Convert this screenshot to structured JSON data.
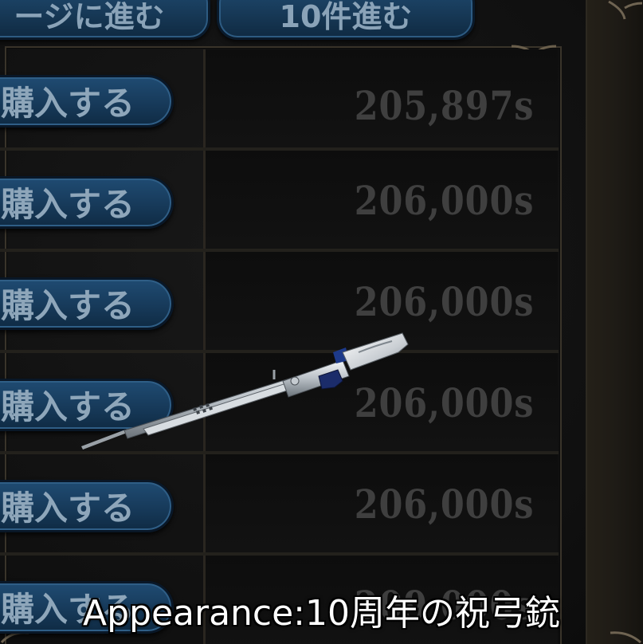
{
  "nav": {
    "prev_page_label": "ージに進む",
    "next10_label": "10件進む"
  },
  "listings": [
    {
      "buy_label": "購入する",
      "price": "205,897s"
    },
    {
      "buy_label": "購入する",
      "price": "206,000s"
    },
    {
      "buy_label": "購入する",
      "price": "206,000s"
    },
    {
      "buy_label": "購入する",
      "price": "206,000s"
    },
    {
      "buy_label": "購入する",
      "price": "206,000s"
    },
    {
      "buy_label": "購入する",
      "price": "209,000s"
    }
  ],
  "preview": {
    "item_icon": "rifle-icon",
    "caption": "Appearance:10周年の祝弓銃"
  },
  "colors": {
    "button_blue": "#173a5a",
    "price_text": "#3f3f3f",
    "caption_text": "#ffffff"
  }
}
